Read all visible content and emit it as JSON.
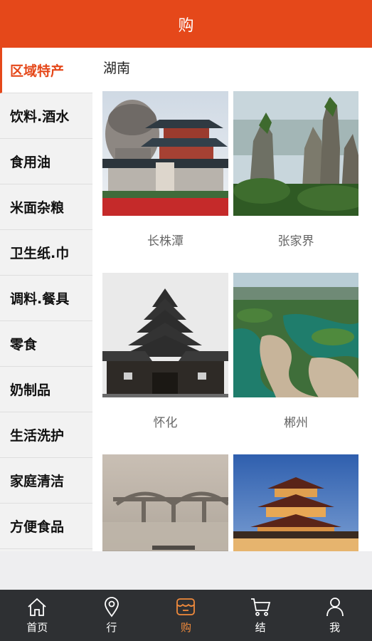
{
  "header": {
    "title": "购"
  },
  "sidebar": {
    "items": [
      {
        "label": "区域特产",
        "active": true
      },
      {
        "label": "饮料.酒水",
        "active": false
      },
      {
        "label": "食用油",
        "active": false
      },
      {
        "label": "米面杂粮",
        "active": false
      },
      {
        "label": "卫生纸.巾",
        "active": false
      },
      {
        "label": "调料.餐具",
        "active": false
      },
      {
        "label": "零食",
        "active": false
      },
      {
        "label": "奶制品",
        "active": false
      },
      {
        "label": "生活洗护",
        "active": false
      },
      {
        "label": "家庭清洁",
        "active": false
      },
      {
        "label": "方便食品",
        "active": false
      }
    ]
  },
  "main": {
    "region_title": "湖南",
    "cities": [
      {
        "name": "长株潭",
        "image": "mao-statue-pavilion"
      },
      {
        "name": "张家界",
        "image": "sandstone-pillars"
      },
      {
        "name": "怀化",
        "image": "drum-tower"
      },
      {
        "name": "郴州",
        "image": "lake-danxia"
      },
      {
        "name": "",
        "image": "misty-bridge"
      },
      {
        "name": "",
        "image": "night-pavilion"
      }
    ]
  },
  "tabbar": {
    "items": [
      {
        "label": "首页",
        "icon": "home-icon",
        "active": false
      },
      {
        "label": "行",
        "icon": "location-pin-icon",
        "active": false
      },
      {
        "label": "购",
        "icon": "shop-icon",
        "active": true
      },
      {
        "label": "结",
        "icon": "cart-icon",
        "active": false
      },
      {
        "label": "我",
        "icon": "user-icon",
        "active": false
      }
    ]
  },
  "colors": {
    "accent": "#e5481a",
    "active_tab": "#f08a3c",
    "tabbar_bg": "#2e3033"
  }
}
